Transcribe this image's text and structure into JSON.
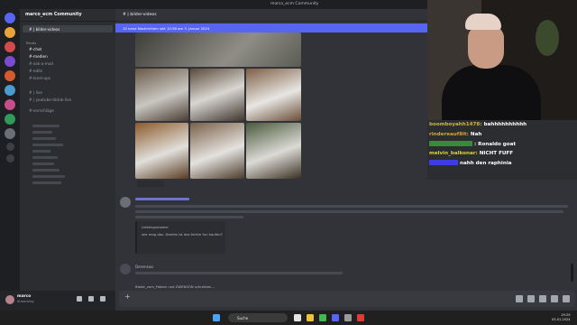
{
  "window": {
    "title": "marco_ecm Community"
  },
  "server": {
    "name": "marco_ecm Community"
  },
  "channels": [
    {
      "label": "# | bilder-videos",
      "active": true
    },
    {
      "label": "Trikots",
      "category": true
    },
    {
      "label": "#-chat"
    },
    {
      "label": "#-medien"
    },
    {
      "label": "#-ask-a-mod"
    },
    {
      "label": "#-edits"
    },
    {
      "label": "#-level-ups"
    },
    {
      "label": "# | live"
    },
    {
      "label": "# | youtube-tiktok-live"
    },
    {
      "label": "#-vorschläge"
    }
  ],
  "user": {
    "name": "marco",
    "status": "Streaming"
  },
  "chat": {
    "channel": "# | bilder-videos",
    "banner": "10 neue Nachrichten seit 10:58 am 3. Januar 2024",
    "embed_lines": [
      "Lieblingsmarke:",
      "wie mag das. Damits ist das fahrte fun kaufen?"
    ],
    "second_author": "Derensoo",
    "typing": "Blade_vom_Fabian und ZWENSON schreiben..."
  },
  "stream_chat": {
    "messages": [
      {
        "user": "boomboyahh1478:",
        "text": "bahhhhhhhhhh",
        "color": "#d6b63b"
      },
      {
        "user": "rindereauf8it:",
        "text": "Nah",
        "color": "#d9a534"
      },
      {
        "user": "",
        "text": ": Ronaldo goat",
        "color": "#3a8a3e"
      },
      {
        "user": "melvin_balkonar:",
        "text": "NICHT FUFF",
        "color": "#e0d431"
      },
      {
        "user": "",
        "text": "nahh den raphinia",
        "color": "#3c3ee0"
      }
    ]
  },
  "taskbar": {
    "search": "Suche",
    "time": "19:29",
    "date": "03.01.2024"
  }
}
